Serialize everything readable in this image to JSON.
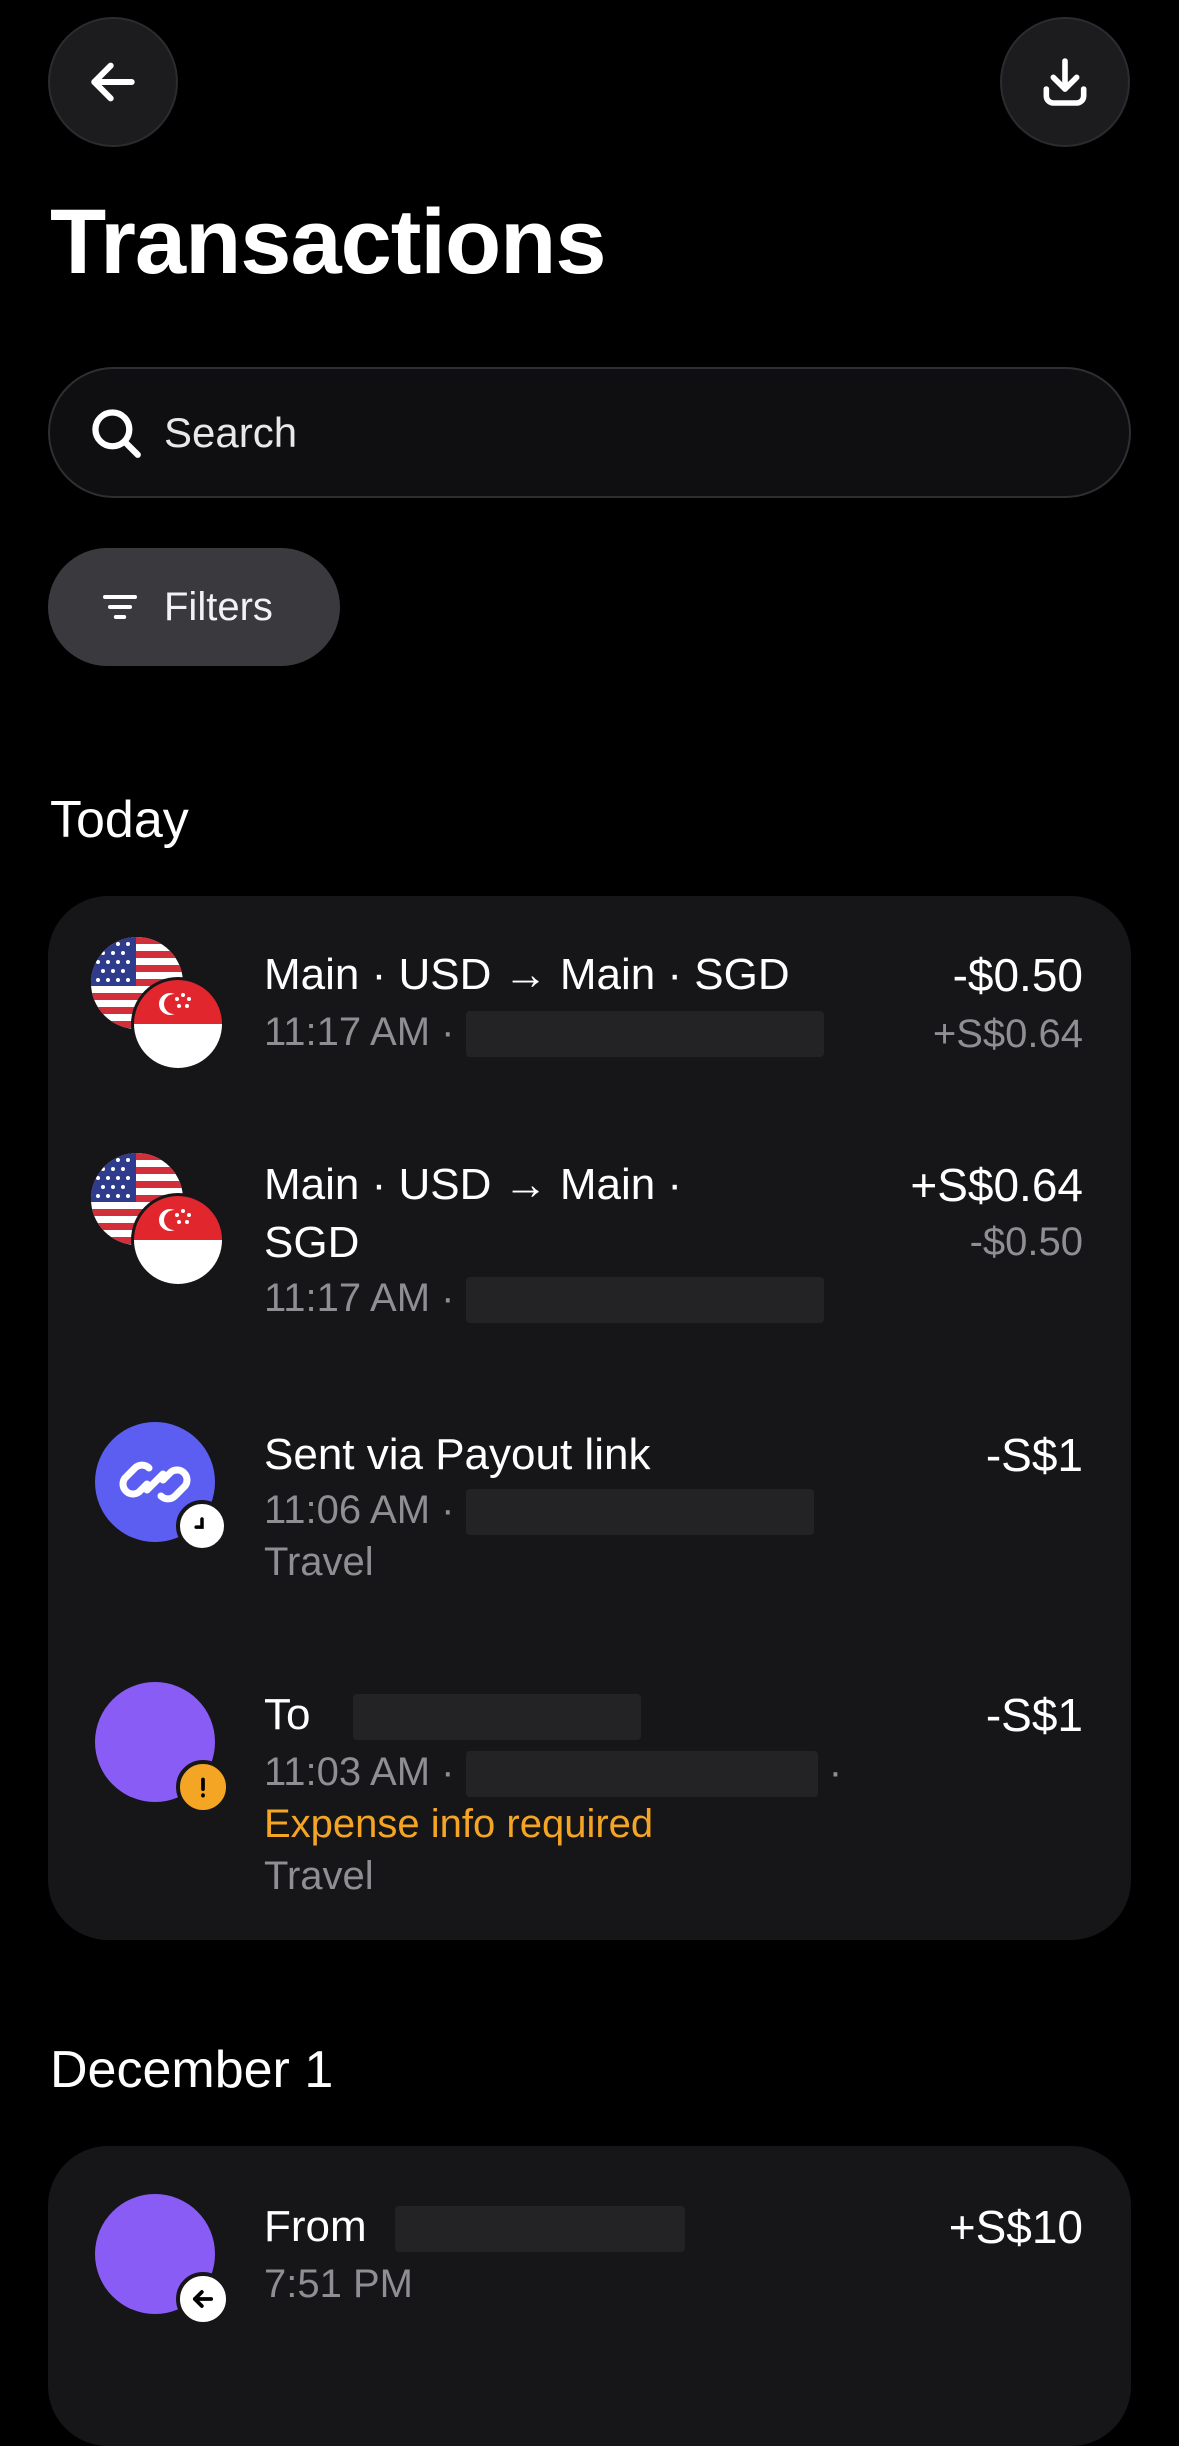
{
  "header": {
    "title": "Transactions",
    "back_icon": "arrow-left-icon",
    "download_icon": "download-icon"
  },
  "search": {
    "placeholder": "Search"
  },
  "filters": {
    "label": "Filters"
  },
  "colors": {
    "background": "#000000",
    "card": "#161618",
    "secondary_text": "#8e8e93",
    "warning": "#f5a524",
    "link_avatar": "#5b5ef0",
    "person_avatar": "#8a5cf6"
  },
  "sections": [
    {
      "title": "Today",
      "transactions": [
        {
          "name": "Main · USD → Main · SGD",
          "time": "11:17 AM ·",
          "amount": "-$0.50",
          "secondary_amount": "+S$0.64",
          "icon": "usd-sgd-flags-icon"
        },
        {
          "name": "Main · USD → Main · SGD",
          "time": "11:17 AM ·",
          "amount": "+S$0.64",
          "secondary_amount": "-$0.50",
          "icon": "usd-sgd-flags-icon"
        },
        {
          "name": "Sent via Payout link",
          "time": "11:06 AM ·",
          "category": "Travel",
          "amount": "-S$1",
          "icon": "link-icon",
          "badge": "clock-icon"
        },
        {
          "name": "To",
          "time": "11:03 AM ·",
          "trailing": "·",
          "warning": "Expense info required",
          "category": "Travel",
          "amount": "-S$1",
          "icon": "person-avatar",
          "badge": "exclamation-icon"
        }
      ]
    },
    {
      "title": "December 1",
      "transactions": [
        {
          "name": "From",
          "time": "7:51 PM",
          "amount": "+S$10",
          "icon": "person-avatar",
          "badge": "arrow-left-icon"
        }
      ]
    }
  ]
}
